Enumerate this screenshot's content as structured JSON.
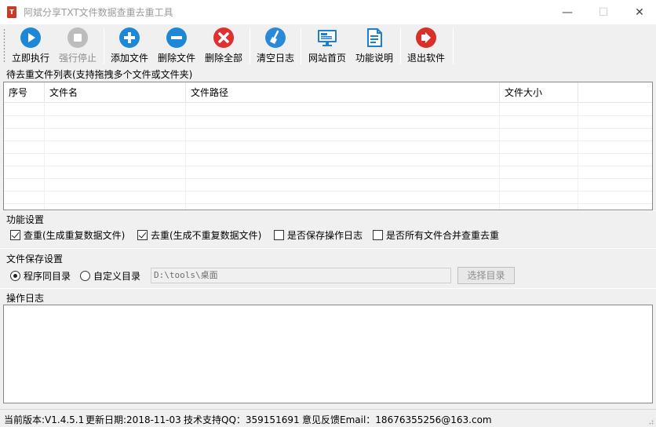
{
  "window": {
    "title": "阿斌分享TXT文件数据查重去重工具",
    "min_glyph": "—",
    "max_glyph": "☐",
    "close_glyph": "✕"
  },
  "toolbar": {
    "buttons": [
      {
        "label": "立即执行",
        "icon": "play-icon",
        "color": "#1e88d6",
        "enabled": true
      },
      {
        "label": "强行停止",
        "icon": "stop-icon",
        "color": "#b8b8b8",
        "enabled": false
      },
      {
        "label": "添加文件",
        "icon": "plus-icon",
        "color": "#1e88d6",
        "enabled": true
      },
      {
        "label": "删除文件",
        "icon": "minus-icon",
        "color": "#1e88d6",
        "enabled": true
      },
      {
        "label": "删除全部",
        "icon": "close-icon",
        "color": "#e02f2f",
        "enabled": true
      },
      {
        "label": "清空日志",
        "icon": "broom-icon",
        "color": "#2b8ad8",
        "enabled": true
      },
      {
        "label": "网站首页",
        "icon": "monitor-icon",
        "color": "#1e7fd0",
        "enabled": true
      },
      {
        "label": "功能说明",
        "icon": "document-icon",
        "color": "#1e7fd0",
        "enabled": true
      },
      {
        "label": "退出软件",
        "icon": "exit-icon",
        "color": "#d9302a",
        "enabled": true
      }
    ]
  },
  "file_list": {
    "label": "待去重文件列表(支持拖拽多个文件或文件夹)",
    "columns": [
      "序号",
      "文件名",
      "文件路径",
      "文件大小"
    ],
    "rows": []
  },
  "settings": {
    "label": "功能设置",
    "options": [
      {
        "label": "查重(生成重复数据文件)",
        "checked": true
      },
      {
        "label": "去重(生成不重复数据文件)",
        "checked": true
      },
      {
        "label": "是否保存操作日志",
        "checked": false
      },
      {
        "label": "是否所有文件合并查重去重",
        "checked": false
      }
    ]
  },
  "save": {
    "label": "文件保存设置",
    "radio_same": "程序同目录",
    "radio_custom": "自定义目录",
    "selected": "程序同目录",
    "path_value": "D:\\tools\\桌面",
    "choose_button": "选择目录"
  },
  "log": {
    "label": "操作日志",
    "content": ""
  },
  "status": {
    "version": "当前版本:V1.4.5.1",
    "update_date": "更新日期:2018-11-03",
    "support": "技术支持QQ：359151691",
    "feedback": "意见反馈Email：18676355256@163.com"
  }
}
